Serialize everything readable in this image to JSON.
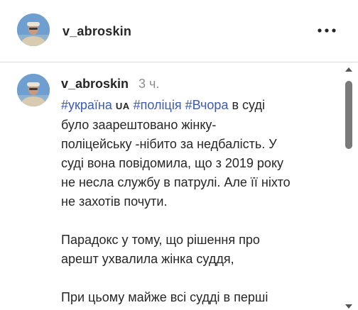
{
  "header": {
    "username": "v_abroskin",
    "more_icon": "more-horizontal-icon"
  },
  "post": {
    "username": "v_abroskin",
    "time": "3 ч.",
    "caption": {
      "tag_1": "#україна",
      "flag": "UA",
      "tag_2": "#поліція",
      "tag_3": "#Вчора",
      "line_1_rest": "в суді",
      "line_2": "було заарештовано жінку-",
      "line_3": "поліцейську -нібито за недбалість. У",
      "line_4": "суді вона повідомила, що з 2019 року",
      "line_5": "не несла службу в патрулі. Але її ніхто",
      "line_6": "не захотів почути.",
      "line_7": "Парадокс у тому, що рішення про",
      "line_8": "арешт ухвалила жінка суддя,",
      "line_9": "При цьому майже всі судді в перші"
    }
  },
  "colors": {
    "hashtag": "#3b5ab6",
    "text": "#262626",
    "muted": "#8e8e8e",
    "divider": "#dbdbdb",
    "scroll_thumb": "#7a7a7a"
  }
}
